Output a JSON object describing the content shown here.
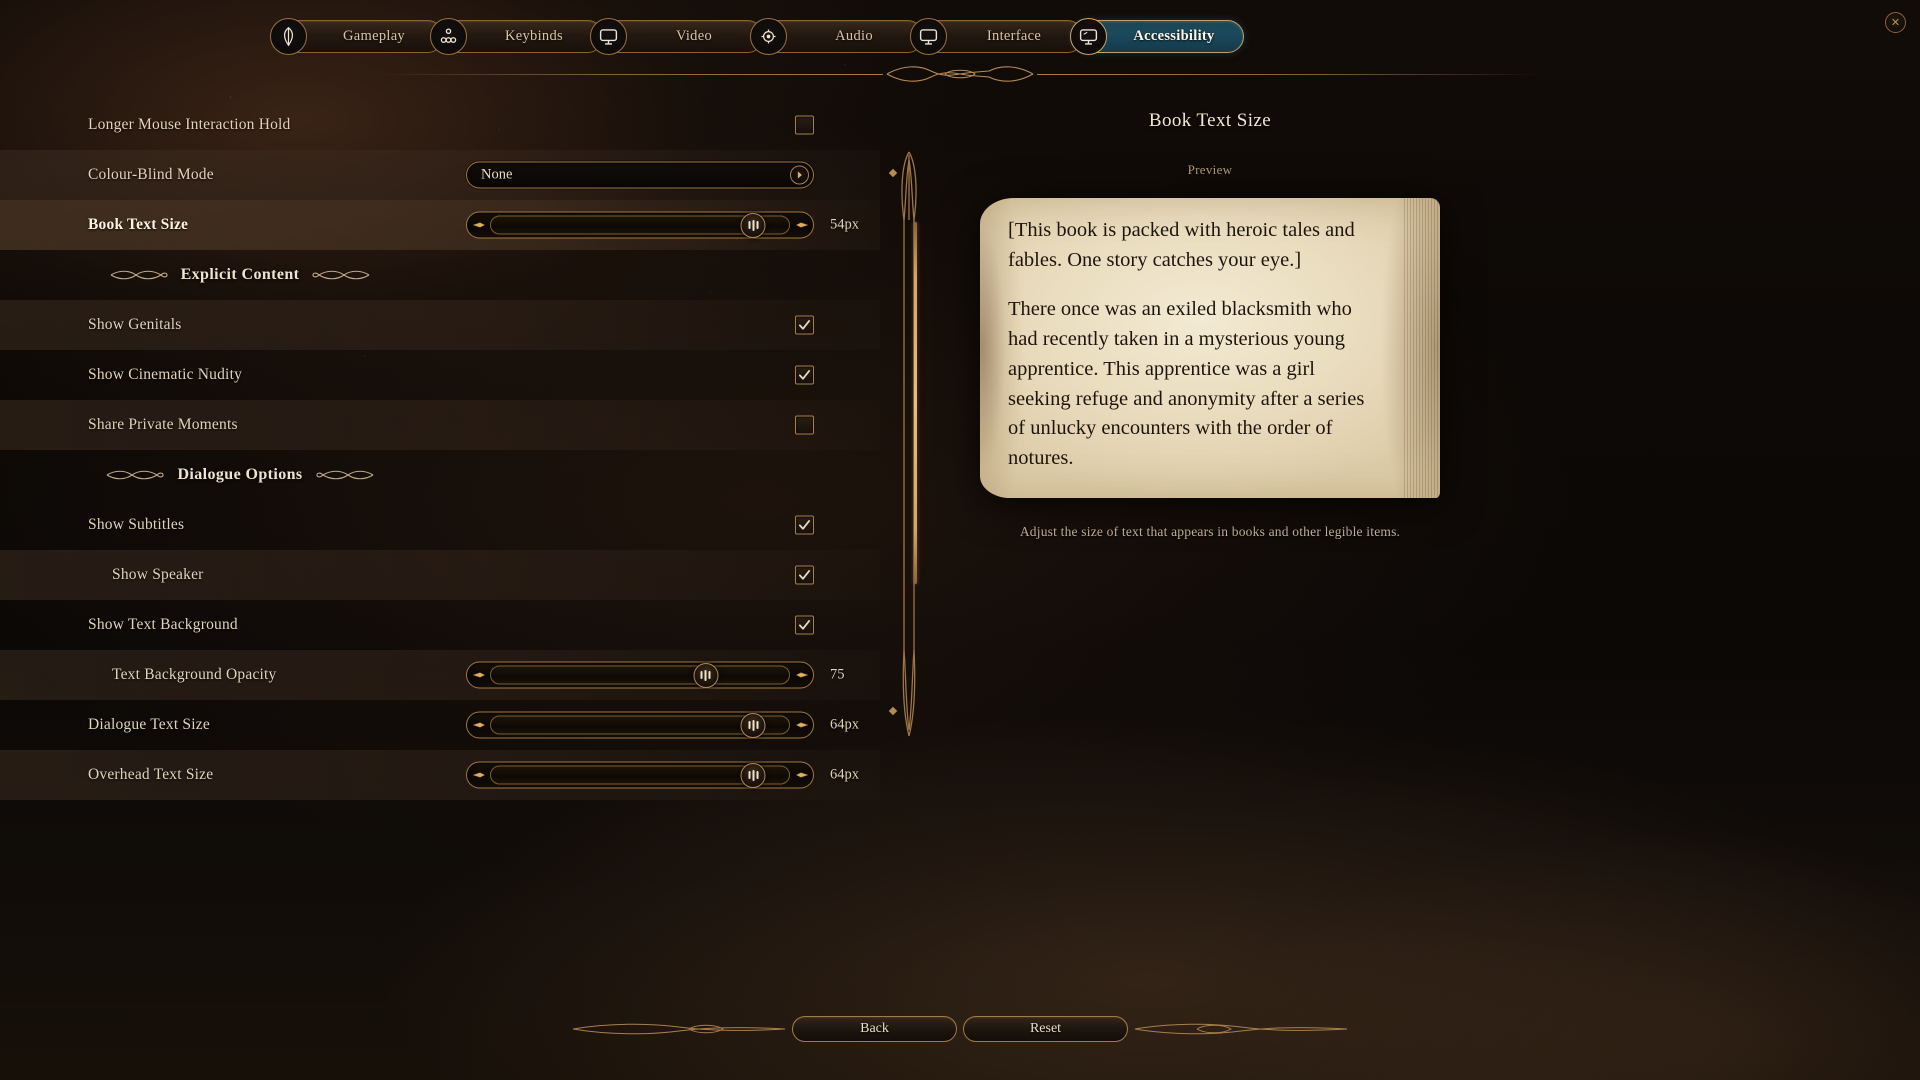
{
  "window": {
    "close_label": "✕"
  },
  "tabs": [
    {
      "label": "Gameplay",
      "icon": "compass-icon",
      "active": false
    },
    {
      "label": "Keybinds",
      "icon": "keys-icon",
      "active": false
    },
    {
      "label": "Video",
      "icon": "monitor-icon",
      "active": false
    },
    {
      "label": "Audio",
      "icon": "speaker-icon",
      "active": false
    },
    {
      "label": "Interface",
      "icon": "monitor-icon",
      "active": false
    },
    {
      "label": "Accessibility",
      "icon": "monitor-accessibility-icon",
      "active": true
    }
  ],
  "settings": [
    {
      "label": "Longer Mouse Interaction Hold",
      "type": "checkbox",
      "checked": false,
      "indent": 0,
      "band": "plain",
      "selected": false
    },
    {
      "label": "Colour-Blind Mode",
      "type": "dropdown",
      "value": "None",
      "indent": 0,
      "band": "alt",
      "selected": false
    },
    {
      "label": "Book Text Size",
      "type": "slider",
      "value": "54px",
      "percent": 88,
      "indent": 0,
      "band": "highlight",
      "selected": true
    },
    {
      "label": "Explicit Content",
      "type": "section",
      "indent": 0
    },
    {
      "label": "Show Genitals",
      "type": "checkbox",
      "checked": true,
      "indent": 0,
      "band": "alt",
      "selected": false
    },
    {
      "label": "Show Cinematic Nudity",
      "type": "checkbox",
      "checked": true,
      "indent": 0,
      "band": "plain",
      "selected": false
    },
    {
      "label": "Share Private Moments",
      "type": "checkbox",
      "checked": false,
      "indent": 0,
      "band": "alt",
      "selected": false
    },
    {
      "label": "Dialogue Options",
      "type": "section",
      "indent": 0
    },
    {
      "label": "Show Subtitles",
      "type": "checkbox",
      "checked": true,
      "indent": 0,
      "band": "plain",
      "selected": false
    },
    {
      "label": "Show Speaker",
      "type": "checkbox",
      "checked": true,
      "indent": 1,
      "band": "alt",
      "selected": false
    },
    {
      "label": "Show Text Background",
      "type": "checkbox",
      "checked": true,
      "indent": 0,
      "band": "plain",
      "selected": false
    },
    {
      "label": "Text Background Opacity",
      "type": "slider",
      "value": "75",
      "percent": 72,
      "indent": 1,
      "band": "alt",
      "selected": false
    },
    {
      "label": "Dialogue Text Size",
      "type": "slider",
      "value": "64px",
      "percent": 88,
      "indent": 0,
      "band": "plain",
      "selected": false
    },
    {
      "label": "Overhead Text Size",
      "type": "slider",
      "value": "64px",
      "percent": 88,
      "indent": 0,
      "band": "alt",
      "selected": false
    }
  ],
  "preview": {
    "title": "Book Text Size",
    "subtitle": "Preview",
    "book_paragraphs": [
      "[This book is packed with heroic tales and fables. One story catches your eye.]",
      "There once was an exiled blacksmith who had recently taken in a mysterious young apprentice. This apprentice was a girl seeking refuge and anonymity after a series of unlucky encounters with the order of notures."
    ],
    "description": "Adjust the size of text that appears in books and other legible items."
  },
  "footer": {
    "back_label": "Back",
    "reset_label": "Reset"
  },
  "colors": {
    "gold": "#a2783f",
    "gold_light": "#d6a468",
    "accent_active_tab": "#1a4a5c",
    "text_cream": "#e3d3bb",
    "page_paper": "#e9dcbe"
  }
}
